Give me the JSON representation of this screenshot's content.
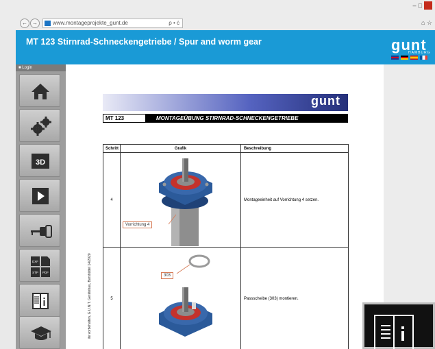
{
  "browser": {
    "url": "www.montageprojekte_gunt.de",
    "address_tools": "ρ • ċ",
    "window_controls": [
      "–",
      "□"
    ],
    "corner_icons": "⌂ ☆"
  },
  "banner": {
    "title": "MT 123 Stirnrad-Schneckengetriebe / Spur and worm gear",
    "logo": "gunt",
    "logo_sub": "HAMBURG",
    "flags": [
      "uk",
      "de",
      "es",
      "fr"
    ]
  },
  "sidebar": {
    "login_label": "Login",
    "buttons": [
      {
        "name": "home",
        "icon": "home-icon"
      },
      {
        "name": "gears",
        "icon": "gears-icon"
      },
      {
        "name": "3d",
        "icon": "3d-icon",
        "label": "3D"
      },
      {
        "name": "play",
        "icon": "play-icon"
      },
      {
        "name": "key-config",
        "icon": "key-icon"
      },
      {
        "name": "downloads",
        "icon": "file-formats-icon",
        "labels": [
          "DXF",
          "STP",
          "PDF"
        ]
      },
      {
        "name": "manual",
        "icon": "book-info-icon"
      },
      {
        "name": "education",
        "icon": "graduation-cap-icon"
      }
    ]
  },
  "document": {
    "header_logo": "gunt",
    "code": "MT 123",
    "heading": "MONTAGEÜBUNG STIRNRAD-SCHNECKENGETRIEBE",
    "columns": [
      "Schritt",
      "Grafik",
      "Beschreibung"
    ],
    "rows": [
      {
        "step": "4",
        "callout": "Vorrichtung 4",
        "description": "Montageeinheit auf Vorrichtung 4 setzen."
      },
      {
        "step": "5",
        "callout": "303",
        "description": "Passscheibe (303) montieren."
      }
    ],
    "side_note": "ite vorbehalten, G.U.N.T. Gerätebau, Barsbüttel 14/2020"
  },
  "colors": {
    "banner": "#1a9ad6",
    "sidebar": "#9d9d9d",
    "gear_red": "#c4322c",
    "housing_blue": "#2b5a9a"
  }
}
